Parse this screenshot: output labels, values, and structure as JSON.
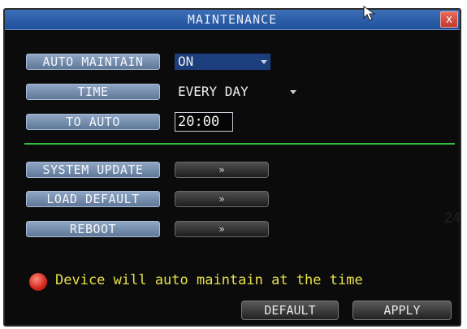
{
  "window": {
    "title": "MAINTENANCE",
    "close_label": "x"
  },
  "fields": {
    "auto_maintain": {
      "label": "AUTO MAINTAIN",
      "value": "ON"
    },
    "time": {
      "label": "TIME",
      "value": "EVERY DAY"
    },
    "to_auto": {
      "label": "TO AUTO",
      "value": "20:00"
    }
  },
  "actions": [
    {
      "label": "SYSTEM UPDATE",
      "button": "»"
    },
    {
      "label": "LOAD DEFAULT",
      "button": "»"
    },
    {
      "label": "REBOOT",
      "button": "»"
    }
  ],
  "status": {
    "text": "Device will auto maintain at the time",
    "color": "#d3261c"
  },
  "footer": {
    "default_label": "DEFAULT",
    "apply_label": "APPLY"
  },
  "page_number": "24",
  "colors": {
    "title_bar": "#2a5aa6",
    "accent_line": "#2fbf3f",
    "status_text": "#e8e14a"
  }
}
